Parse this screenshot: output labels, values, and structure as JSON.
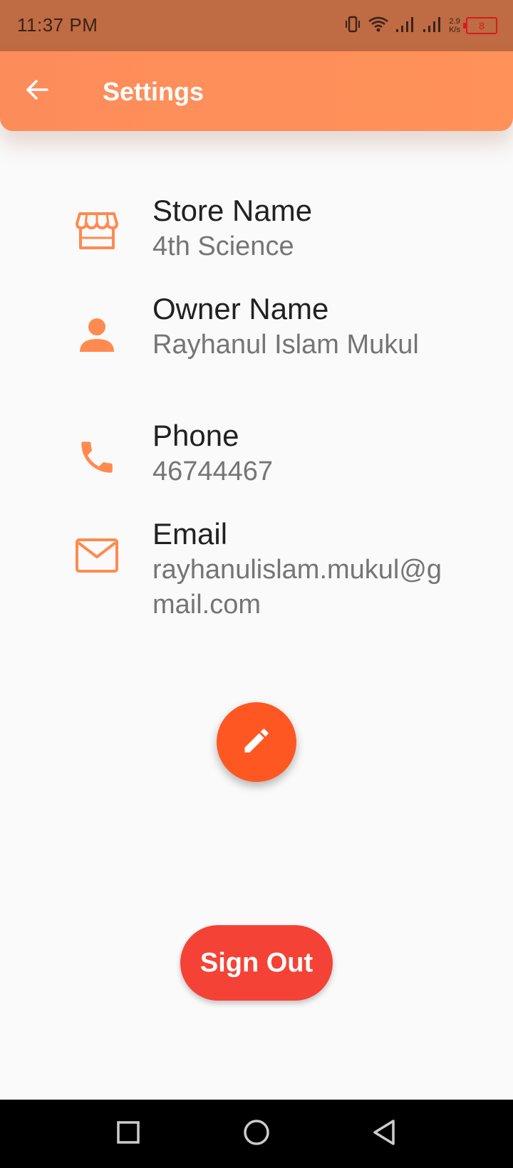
{
  "status_bar": {
    "time": "11:37 PM",
    "net_speed_value": "2.9",
    "net_speed_unit": "K/s",
    "battery_level": "8",
    "icons": [
      "vibrate-icon",
      "wifi-icon",
      "signal-icon",
      "signal-icon",
      "battery-icon"
    ]
  },
  "app_bar": {
    "title": "Settings",
    "back_icon": "arrow-back-icon"
  },
  "profile": {
    "store": {
      "label": "Store Name",
      "value": "4th Science",
      "icon": "store-icon"
    },
    "owner": {
      "label": "Owner Name",
      "value": "Rayhanul Islam Mukul",
      "icon": "person-icon"
    },
    "phone": {
      "label": "Phone",
      "value": "46744467",
      "icon": "phone-icon"
    },
    "email": {
      "label": "Email",
      "value": "rayhanulislam.mukul@gmail.com",
      "icon": "mail-icon"
    }
  },
  "actions": {
    "edit_icon": "pencil-icon",
    "sign_out_label": "Sign Out"
  },
  "nav_bar": {
    "icons": [
      "recent-apps-icon",
      "home-icon",
      "back-icon"
    ]
  },
  "colors": {
    "status_bar": "#bf6b43",
    "app_bar": "#ff8f5a",
    "accent_icon": "#ff8a50",
    "fab": "#ff5722",
    "sign_out": "#f44336",
    "background": "#fafafa"
  }
}
